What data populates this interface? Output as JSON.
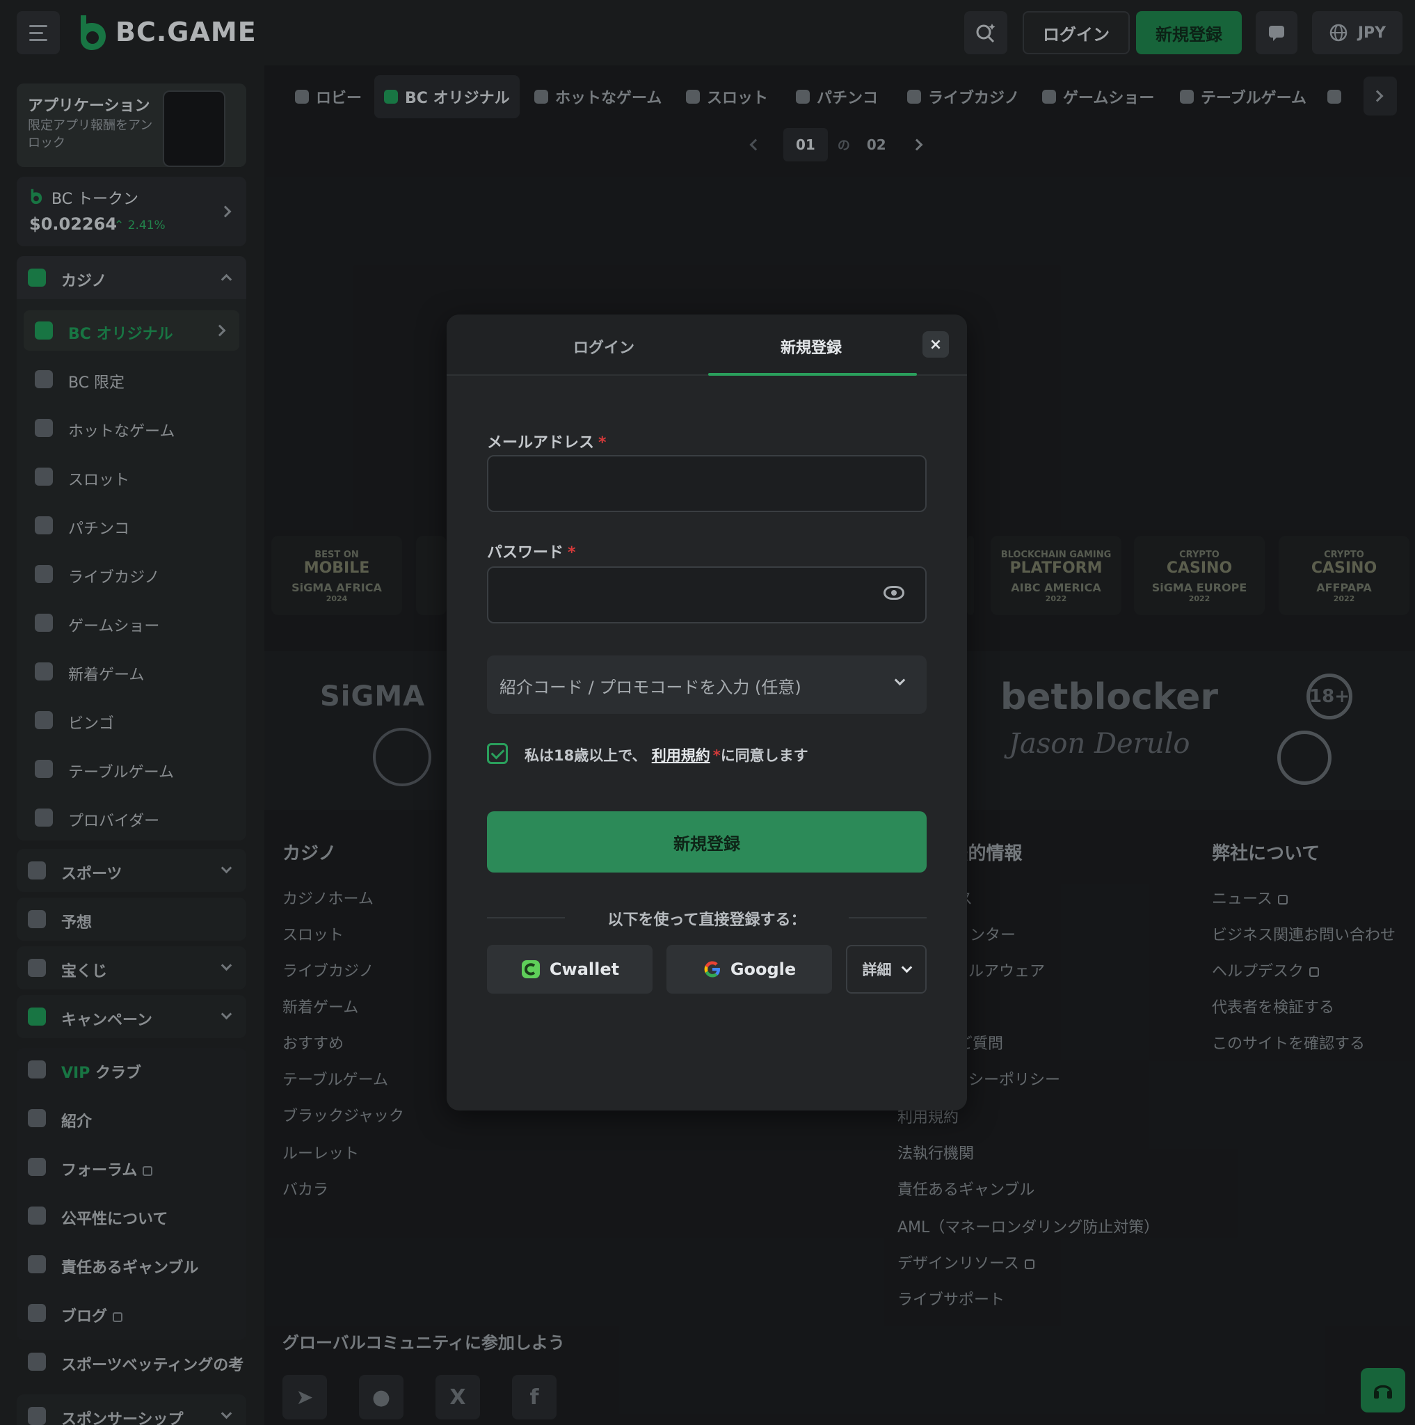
{
  "brand": {
    "name": "BC.GAME",
    "accent": "#1e8f52"
  },
  "topbar": {
    "login": "ログイン",
    "register": "新規登録",
    "currency": "JPY"
  },
  "sidebar": {
    "app": {
      "title": "アプリケーション",
      "subtitle": "限定アプリ報酬をアンロック"
    },
    "token": {
      "title": "BC トークン",
      "price": "$0.02264",
      "change": "2.41%"
    },
    "casino": {
      "title": "カジノ",
      "items": [
        {
          "label": "BC オリジナル",
          "icon": "bc-logo-icon"
        },
        {
          "label": "BC 限定",
          "icon": "gamepad-icon"
        },
        {
          "label": "ホットなゲーム",
          "icon": "flame-icon"
        },
        {
          "label": "スロット",
          "icon": "slot-icon"
        },
        {
          "label": "パチンコ",
          "icon": "pachinko-icon"
        },
        {
          "label": "ライブカジノ",
          "icon": "live-casino-icon"
        },
        {
          "label": "ゲームショー",
          "icon": "game-show-icon"
        },
        {
          "label": "新着ゲーム",
          "icon": "rocket-icon"
        },
        {
          "label": "ビンゴ",
          "icon": "bingo-icon"
        },
        {
          "label": "テーブルゲーム",
          "icon": "cards-icon"
        },
        {
          "label": "プロバイダー",
          "icon": "star-icon"
        }
      ]
    },
    "sports": "スポーツ",
    "prediction": "予想",
    "lottery": "宝くじ",
    "campaign": "キャンペーン",
    "vip": {
      "prefix": "VIP",
      "label": "クラブ"
    },
    "referral": "紹介",
    "forum": "フォーラム",
    "fairness": "公平性について",
    "responsible": "責任あるギャンブル",
    "blog": "ブログ",
    "sports_betting": "スポーツベッティングの考",
    "sponsorship": "スポンサーシップ"
  },
  "categories": [
    "ロビー",
    "BC オリジナル",
    "ホットなゲーム",
    "スロット",
    "パチンコ",
    "ライブカジノ",
    "ゲームショー",
    "テーブルゲーム"
  ],
  "pager": {
    "current": "01",
    "sep": "の",
    "total": "02"
  },
  "awards": [
    {
      "top": "BEST ON",
      "main": "MOBILE",
      "org": "SiGMA AFRICA",
      "year": "2024"
    },
    {
      "top": "BLOCKCHAIN GAMING",
      "main": "PLATFORM",
      "org": "AIBC AMERICA",
      "year": "2022"
    },
    {
      "top": "CRYPTO",
      "main": "CASINO",
      "org": "SiGMA EUROPE",
      "year": "2022"
    },
    {
      "top": "CRYPTO",
      "main": "CASINO",
      "org": "AFFPAPA",
      "year": "2022"
    }
  ],
  "partners": {
    "sigma": "SiGMA",
    "betblocker": "betblocker",
    "signature": "Jason Derulo",
    "age": "18+"
  },
  "footer": {
    "casino_title": "カジノ",
    "casino_links": [
      "カジノホーム",
      "スロット",
      "ライブカジノ",
      "新着ゲーム",
      "おすすめ",
      "テーブルゲーム",
      "ブラックジャック",
      "ルーレット",
      "バカラ"
    ],
    "legal_title": "/法的情報",
    "legal_links": [
      "ス",
      "ンター",
      "ルアウェア",
      "",
      "ご質問",
      "シーポリシー",
      "利用規約",
      "法執行機関",
      "責任あるギャンブル",
      "AML（マネーロンダリング防止対策）",
      "デザインリソース",
      "ライブサポート"
    ],
    "about_title": "弊社について",
    "about_links": [
      "ニュース",
      "ビジネス関連お問い合わせ",
      "ヘルプデスク",
      "代表者を検証する",
      "このサイトを確認する"
    ],
    "community": "グローバルコミュニティに参加しよう"
  },
  "modal": {
    "tab_login": "ログイン",
    "tab_register": "新規登録",
    "close": "×",
    "email_label": "メールアドレス",
    "email_value": "",
    "password_label": "パスワード",
    "password_value": "",
    "required_mark": "*",
    "promo": "紹介コード / プロモコードを入力 (任意)",
    "agree_prefix": "私は18歳以上で、",
    "agree_link": "利用規約",
    "agree_suffix": "に同意します",
    "submit": "新規登録",
    "or_text": "以下を使って直接登録する：",
    "cwallet": "Cwallet",
    "google": "Google",
    "more": "詳細"
  }
}
